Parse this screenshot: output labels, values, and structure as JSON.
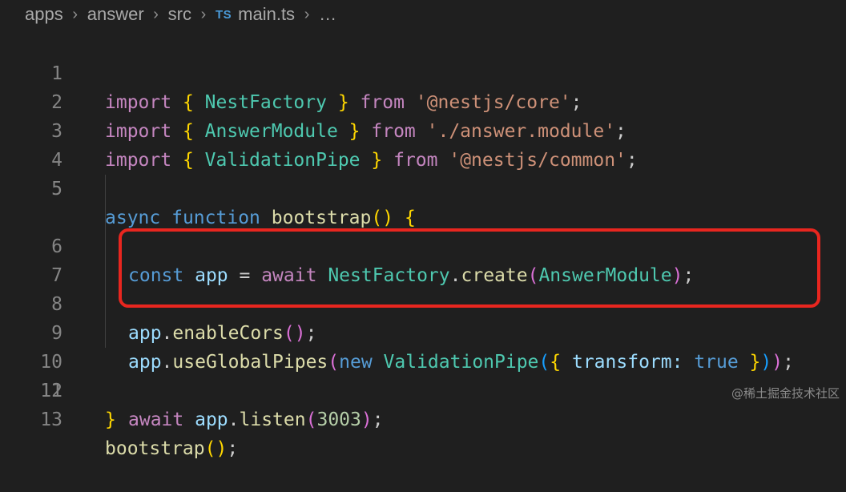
{
  "breadcrumb": {
    "items": [
      "apps",
      "answer",
      "src",
      "main.ts",
      "…"
    ],
    "file_badge": "TS",
    "separator": "›"
  },
  "editor": {
    "line_numbers": [
      "1",
      "2",
      "3",
      "4",
      "5",
      "6",
      "7",
      "8",
      "9",
      "10",
      "11",
      "12",
      "13"
    ],
    "tokens": {
      "import": "import",
      "from": "from",
      "lbrace": "{ ",
      "rbrace": " }",
      "semicolon": ";",
      "nestFactory": "NestFactory",
      "answerModule": "AnswerModule",
      "validationPipe": "ValidationPipe",
      "str_core": "'@nestjs/core'",
      "str_module": "'./answer.module'",
      "str_common": "'@nestjs/common'",
      "async": "async",
      "function": "function",
      "bootstrap": "bootstrap",
      "lparen": "(",
      "rparen": ")",
      "const": "const",
      "app": "app",
      "equals": " = ",
      "await": "await",
      "dot": ".",
      "create": "create",
      "enableCors": "enableCors",
      "useGlobalPipes": "useGlobalPipes",
      "new": "new",
      "transform": "transform",
      "colon": ": ",
      "true": "true",
      "listen": "listen",
      "port": "3003",
      "open_brace_only": "{",
      "close_brace_only": "}",
      "space": " "
    }
  },
  "watermark": "@稀土掘金技术社区",
  "colors": {
    "background": "#1f1f1f",
    "keyword": "#c586c0",
    "storage": "#569cd6",
    "variable": "#9cdcfe",
    "function": "#dcdcaa",
    "class": "#4ec9b0",
    "string": "#ce9178",
    "number": "#b5cea8",
    "highlight_border": "#e8261f"
  }
}
